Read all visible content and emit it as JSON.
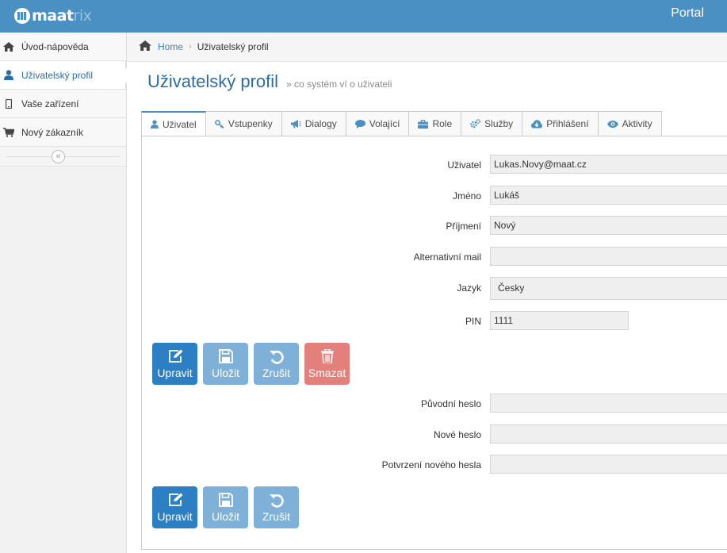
{
  "header": {
    "logo_text_main": "maat",
    "logo_text_fade": "rix",
    "portal": "Portal"
  },
  "sidebar": {
    "items": [
      {
        "label": "Úvod-nápověda",
        "icon": "home-icon"
      },
      {
        "label": "Uživatelský profil",
        "icon": "user-icon",
        "active": true
      },
      {
        "label": "Vaše zařízení",
        "icon": "mobile-icon"
      },
      {
        "label": "Nový zákazník",
        "icon": "cart-icon"
      }
    ],
    "collapse_glyph": "«"
  },
  "breadcrumb": {
    "home": "Home",
    "separator": "›",
    "current": "Uživatelský profil"
  },
  "page": {
    "title": "Uživatelský profil",
    "subtitle": "» co systém ví o uživateli"
  },
  "tabs": [
    {
      "label": "Uživatel",
      "icon": "user-icon",
      "active": true
    },
    {
      "label": "Vstupenky",
      "icon": "key-icon"
    },
    {
      "label": "Dialogy",
      "icon": "megaphone-icon"
    },
    {
      "label": "Volající",
      "icon": "chat-icon"
    },
    {
      "label": "Role",
      "icon": "briefcase-icon"
    },
    {
      "label": "Služby",
      "icon": "gears-icon"
    },
    {
      "label": "Přihlášení",
      "icon": "cloud-download-icon"
    },
    {
      "label": "Aktivity",
      "icon": "eye-icon"
    }
  ],
  "form": {
    "user_label": "Uživatel",
    "user_value": "Lukas.Novy@maat.cz",
    "name_label": "Jméno",
    "name_value": "Lukáš",
    "surname_label": "Příjmení",
    "surname_value": "Nový",
    "altmail_label": "Alternativní mail",
    "altmail_value": "",
    "lang_label": "Jazyk",
    "lang_value": "Česky",
    "pin_label": "PIN",
    "pin_value": "1111"
  },
  "password": {
    "old_label": "Původní heslo",
    "new_label": "Nové heslo",
    "confirm_label": "Potvrzení nového hesla"
  },
  "buttons": {
    "edit": "Upravit",
    "save": "Uložit",
    "cancel": "Zrušit",
    "delete": "Smazat"
  },
  "colors": {
    "header": "#4a90c2",
    "primary": "#2c7fc3",
    "light": "#7fb0d8",
    "danger": "#e4807c",
    "title": "#2d6c9d"
  }
}
